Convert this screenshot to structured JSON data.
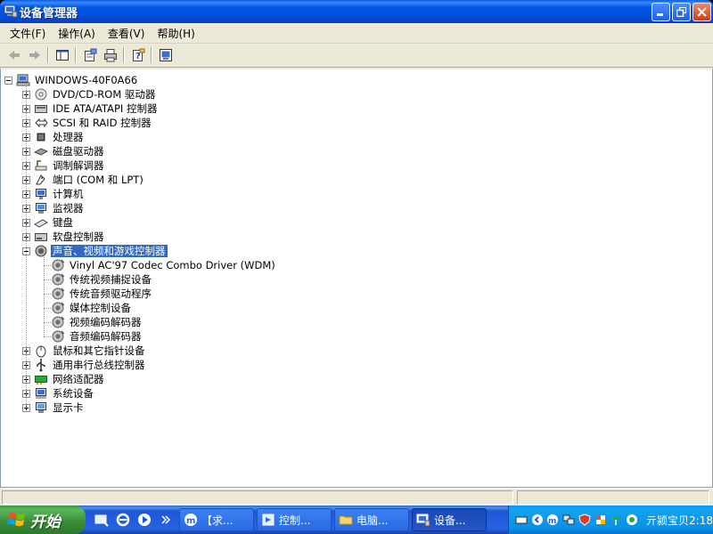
{
  "window": {
    "title": "设备管理器"
  },
  "menu": [
    {
      "label": "文件(F)"
    },
    {
      "label": "操作(A)"
    },
    {
      "label": "查看(V)"
    },
    {
      "label": "帮助(H)"
    }
  ],
  "toolbar": {
    "buttons": [
      "back-icon",
      "forward-icon",
      "show-hide-console-tree-icon",
      "properties-icon",
      "print-icon",
      "help-icon",
      "update-driver-icon"
    ]
  },
  "tree": {
    "root": "WINDOWS-40F0A66",
    "categories": [
      {
        "label": "DVD/CD-ROM 驱动器",
        "icon": "cdrom-icon",
        "expanded": false
      },
      {
        "label": "IDE ATA/ATAPI 控制器",
        "icon": "ide-controller-icon",
        "expanded": false
      },
      {
        "label": "SCSI 和 RAID 控制器",
        "icon": "scsi-icon",
        "expanded": false
      },
      {
        "label": "处理器",
        "icon": "processor-icon",
        "expanded": false
      },
      {
        "label": "磁盘驱动器",
        "icon": "disk-drive-icon",
        "expanded": false
      },
      {
        "label": "调制解调器",
        "icon": "modem-icon",
        "expanded": false
      },
      {
        "label": "端口 (COM 和 LPT)",
        "icon": "port-icon",
        "expanded": false
      },
      {
        "label": "计算机",
        "icon": "computer-icon",
        "expanded": false
      },
      {
        "label": "监视器",
        "icon": "monitor-icon",
        "expanded": false
      },
      {
        "label": "键盘",
        "icon": "keyboard-icon",
        "expanded": false
      },
      {
        "label": "软盘控制器",
        "icon": "floppy-controller-icon",
        "expanded": false
      },
      {
        "label": "声音、视频和游戏控制器",
        "icon": "sound-icon",
        "expanded": true,
        "selected": true,
        "children": [
          "Vinyl AC'97 Codec Combo Driver (WDM)",
          "传统视频捕捉设备",
          "传统音频驱动程序",
          "媒体控制设备",
          "视频编码解码器",
          "音频编码解码器"
        ]
      },
      {
        "label": "鼠标和其它指针设备",
        "icon": "mouse-icon",
        "expanded": false
      },
      {
        "label": "通用串行总线控制器",
        "icon": "usb-icon",
        "expanded": false
      },
      {
        "label": "网络适配器",
        "icon": "network-adapter-icon",
        "expanded": false
      },
      {
        "label": "系统设备",
        "icon": "system-device-icon",
        "expanded": false
      },
      {
        "label": "显示卡",
        "icon": "display-adapter-icon",
        "expanded": false
      }
    ]
  },
  "taskbar": {
    "start_label": "开始",
    "tasks": [
      {
        "label": "【求...",
        "icon": "maxthon-icon",
        "active": false
      },
      {
        "label": "控制...",
        "icon": "control-panel-icon",
        "active": false
      },
      {
        "label": "电脑...",
        "icon": "folder-icon",
        "active": false
      },
      {
        "label": "设备...",
        "icon": "device-manager-icon",
        "active": true
      }
    ],
    "clock": "亓颍宝贝2:18"
  },
  "colors": {
    "selection": "#316ac5",
    "window_face": "#ece9d8",
    "taskbar": "#2663e0",
    "start": "#3c9a3c"
  }
}
